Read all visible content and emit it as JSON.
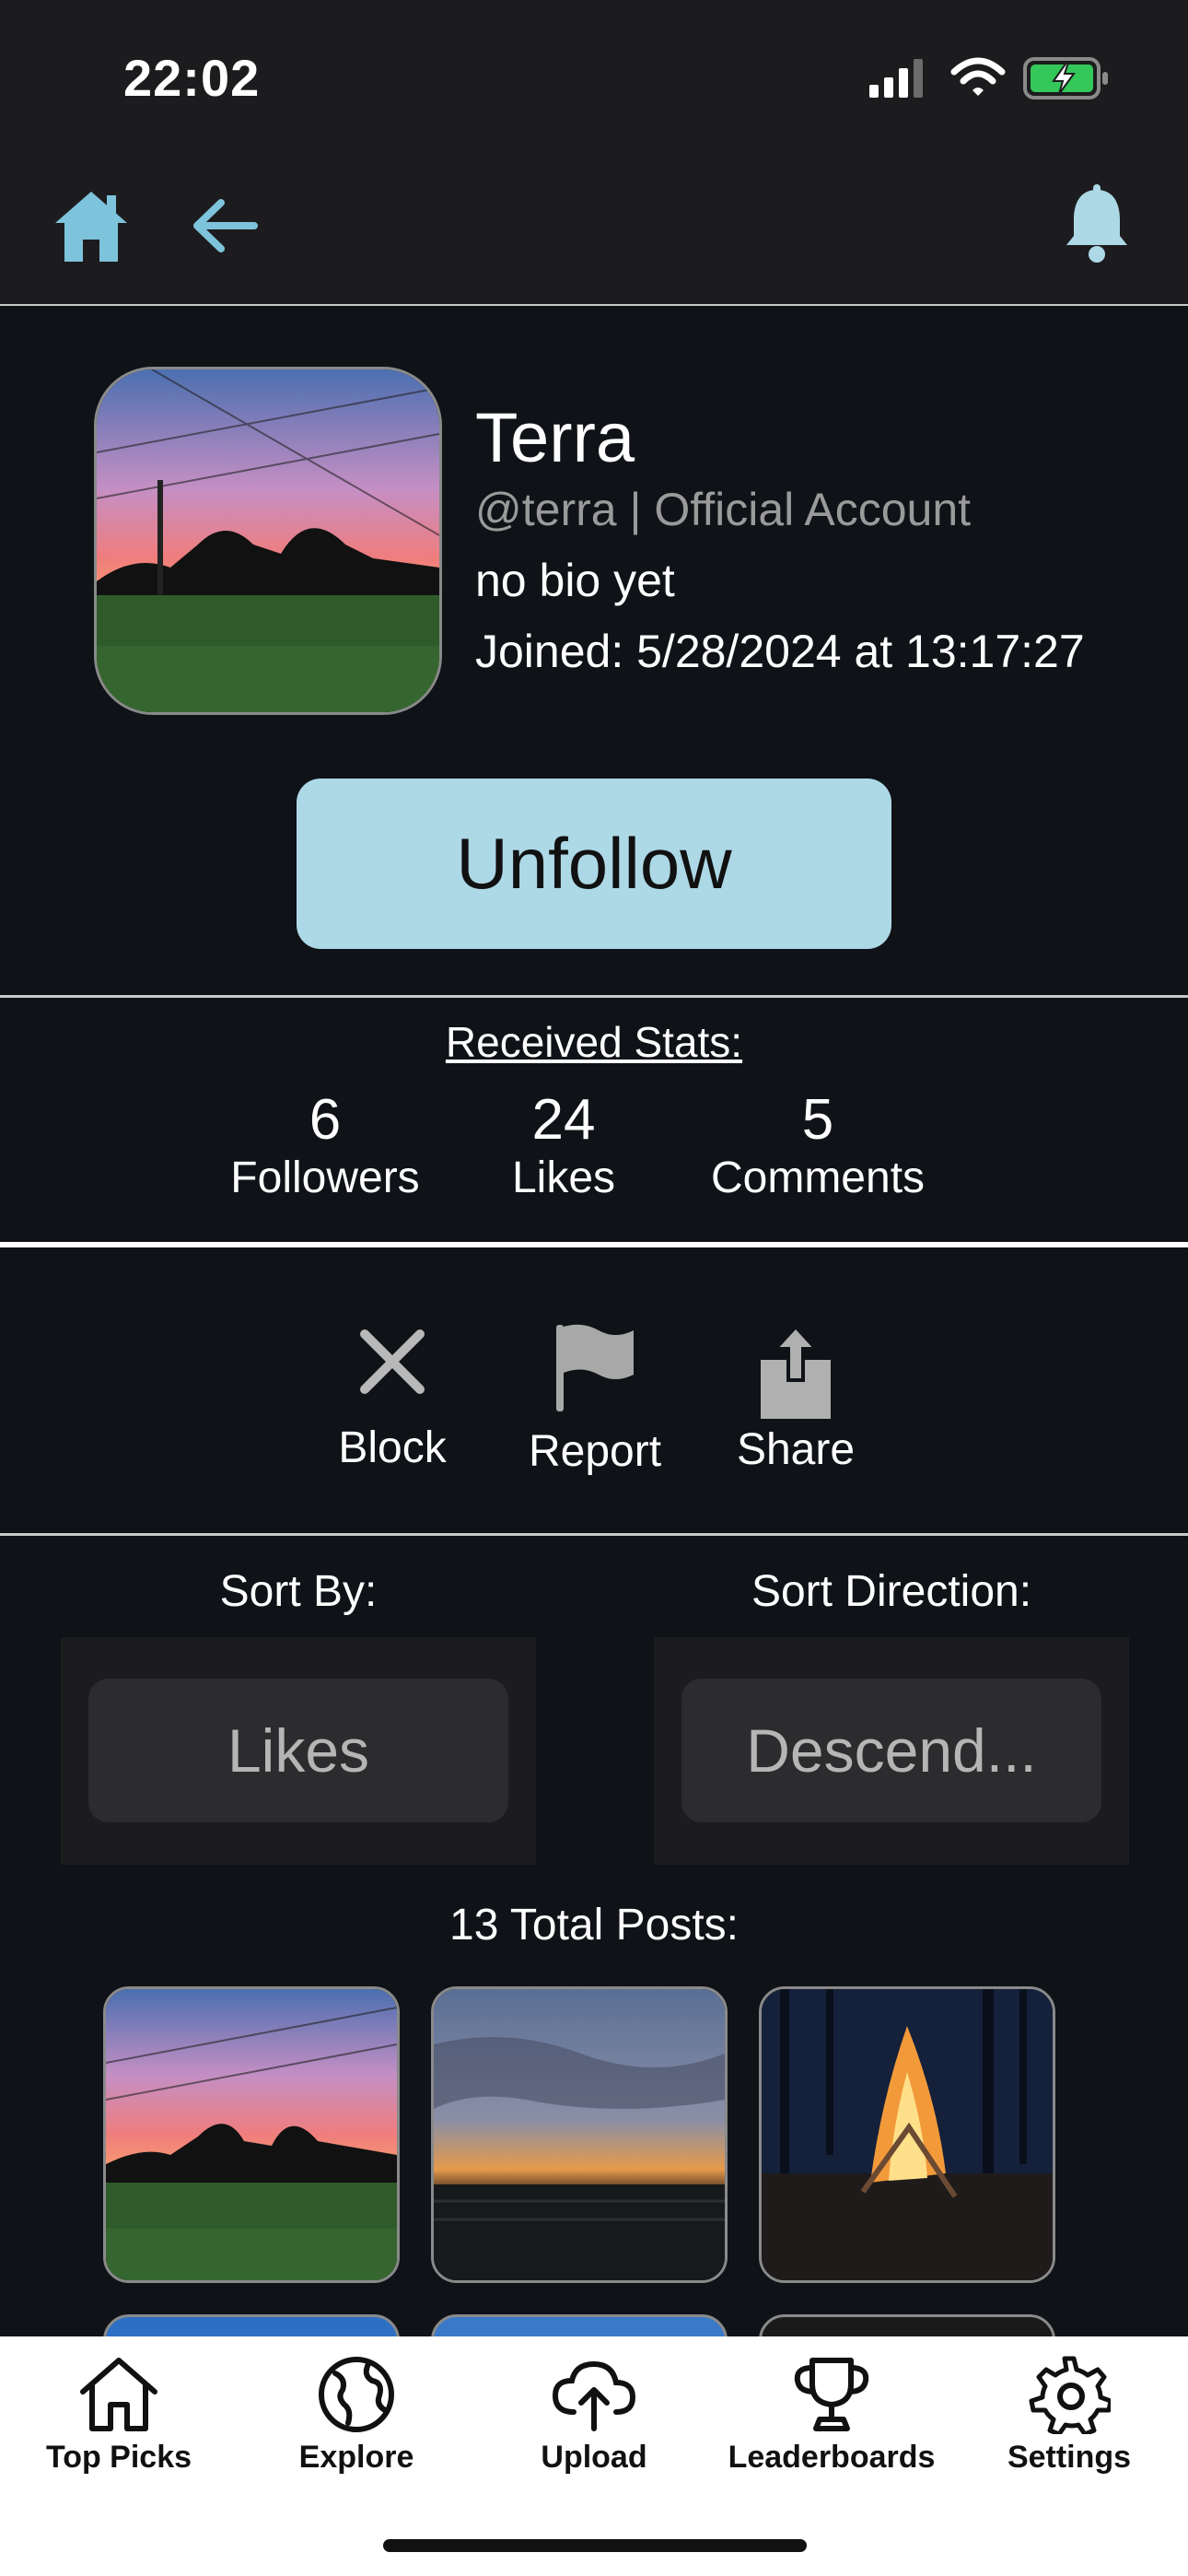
{
  "status_bar": {
    "time": "22:02"
  },
  "profile": {
    "name": "Terra",
    "handle": "@terra | Official Account",
    "bio": "no bio yet",
    "joined": "Joined: 5/28/2024 at 13:17:27",
    "follow_button": "Unfollow"
  },
  "stats": {
    "title": "Received Stats:",
    "items": [
      {
        "value": "6",
        "label": "Followers"
      },
      {
        "value": "24",
        "label": "Likes"
      },
      {
        "value": "5",
        "label": "Comments"
      }
    ]
  },
  "actions": [
    {
      "label": "Block",
      "icon": "close-icon"
    },
    {
      "label": "Report",
      "icon": "flag-icon"
    },
    {
      "label": "Share",
      "icon": "share-icon"
    }
  ],
  "sort": {
    "by_label": "Sort By:",
    "by_value": "Likes",
    "direction_label": "Sort Direction:",
    "direction_value": "Descend..."
  },
  "posts": {
    "title": "13 Total Posts:"
  },
  "tabbar": [
    {
      "label": "Top Picks",
      "icon": "home-icon"
    },
    {
      "label": "Explore",
      "icon": "globe-icon"
    },
    {
      "label": "Upload",
      "icon": "cloud-upload-icon"
    },
    {
      "label": "Leaderboards",
      "icon": "trophy-icon"
    },
    {
      "label": "Settings",
      "icon": "gear-icon"
    }
  ],
  "colors": {
    "accent": "#add8e6",
    "background": "#0f1216",
    "header": "#1c1c1e",
    "battery": "#34c759"
  }
}
